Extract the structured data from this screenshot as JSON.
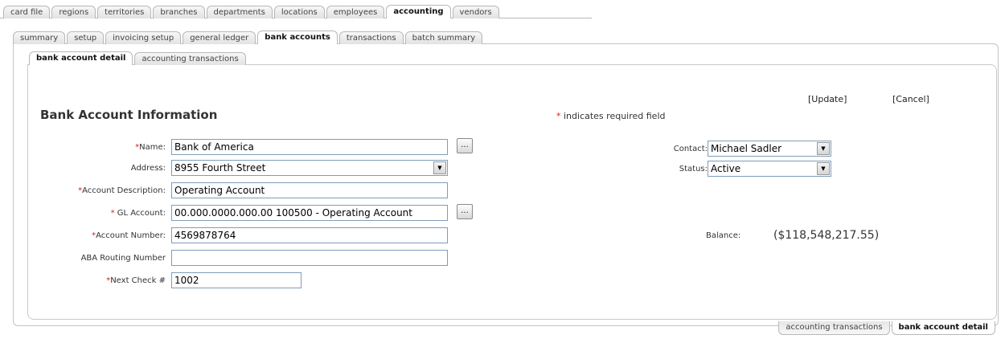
{
  "main_tabs": [
    {
      "label": "card file",
      "active": false
    },
    {
      "label": "regions",
      "active": false
    },
    {
      "label": "territories",
      "active": false
    },
    {
      "label": "branches",
      "active": false
    },
    {
      "label": "departments",
      "active": false
    },
    {
      "label": "locations",
      "active": false
    },
    {
      "label": "employees",
      "active": false
    },
    {
      "label": "accounting",
      "active": true
    },
    {
      "label": "vendors",
      "active": false
    }
  ],
  "sub_tabs": [
    {
      "label": "summary",
      "active": false
    },
    {
      "label": "setup",
      "active": false
    },
    {
      "label": "invoicing setup",
      "active": false
    },
    {
      "label": "general ledger",
      "active": false
    },
    {
      "label": "bank accounts",
      "active": true
    },
    {
      "label": "transactions",
      "active": false
    },
    {
      "label": "batch summary",
      "active": false
    }
  ],
  "detail_tabs": [
    {
      "label": "bank account detail",
      "active": true
    },
    {
      "label": "accounting transactions",
      "active": false
    }
  ],
  "actions": {
    "update": "[Update]",
    "cancel": "[Cancel]"
  },
  "section_title": "Bank Account Information",
  "required_note": {
    "star": "*",
    "text": " indicates required field"
  },
  "form": {
    "name": {
      "star": "*",
      "label": "Name:",
      "value": "Bank of America",
      "browse": "..."
    },
    "address": {
      "label": "Address:",
      "value": "8955 Fourth Street"
    },
    "description": {
      "star": "*",
      "label": "Account Description:",
      "value": "Operating Account"
    },
    "gl_account": {
      "star": "* ",
      "label": "GL Account:",
      "value": "00.000.0000.000.00 100500 - Operating Account",
      "browse": "..."
    },
    "account_number": {
      "star": "*",
      "label": "Account Number:",
      "value": "4569878764"
    },
    "aba_routing": {
      "label": "ABA Routing Number",
      "value": ""
    },
    "next_check": {
      "star": "*",
      "label": "Next Check #",
      "value": "1002"
    },
    "contact": {
      "label": "Contact:",
      "value": "Michael Sadler"
    },
    "status": {
      "label": "Status:",
      "value": "Active"
    },
    "balance": {
      "label": "Balance:",
      "value": "($118,548,217.55)"
    }
  },
  "bottom_tabs": [
    {
      "label": "accounting transactions",
      "active": false
    },
    {
      "label": "bank account detail",
      "active": true
    }
  ],
  "colors": {
    "required_star": "#d42020",
    "field_border": "#7f9db9",
    "panel_border": "#c9c9c9"
  }
}
